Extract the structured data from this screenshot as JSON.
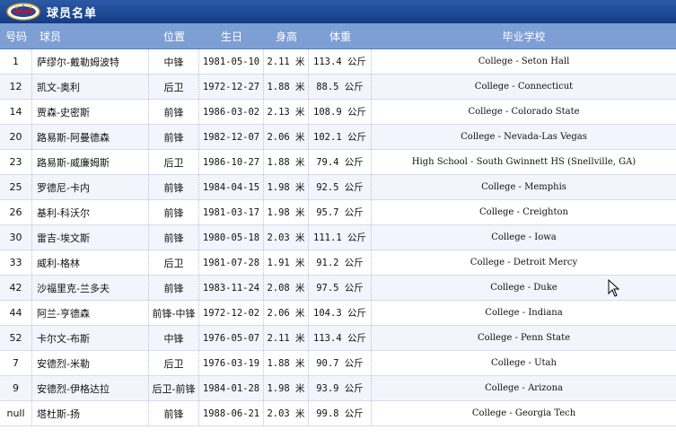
{
  "header": {
    "title": "球员名单"
  },
  "columns": {
    "number": "号码",
    "player": "球员",
    "position": "位置",
    "birthday": "生日",
    "height": "身高",
    "weight": "体重",
    "school": "毕业学校"
  },
  "players": [
    {
      "number": "1",
      "player": "萨缪尔-戴勒姆波特",
      "position": "中锋",
      "birthday": "1981-05-10",
      "height": "2.11 米",
      "weight": "113.4 公斤",
      "school": "College - Seton Hall"
    },
    {
      "number": "12",
      "player": "凯文-奥利",
      "position": "后卫",
      "birthday": "1972-12-27",
      "height": "1.88 米",
      "weight": "88.5 公斤",
      "school": "College - Connecticut"
    },
    {
      "number": "14",
      "player": "贾森-史密斯",
      "position": "前锋",
      "birthday": "1986-03-02",
      "height": "2.13 米",
      "weight": "108.9 公斤",
      "school": "College - Colorado State"
    },
    {
      "number": "20",
      "player": "路易斯-阿曼德森",
      "position": "前锋",
      "birthday": "1982-12-07",
      "height": "2.06 米",
      "weight": "102.1 公斤",
      "school": "College - Nevada-Las Vegas"
    },
    {
      "number": "23",
      "player": "路易斯-威廉姆斯",
      "position": "后卫",
      "birthday": "1986-10-27",
      "height": "1.88 米",
      "weight": "79.4 公斤",
      "school": "High School - South Gwinnett HS (Snellville, GA)"
    },
    {
      "number": "25",
      "player": "罗德尼-卡内",
      "position": "前锋",
      "birthday": "1984-04-15",
      "height": "1.98 米",
      "weight": "92.5 公斤",
      "school": "College - Memphis"
    },
    {
      "number": "26",
      "player": "基利-科沃尔",
      "position": "前锋",
      "birthday": "1981-03-17",
      "height": "1.98 米",
      "weight": "95.7 公斤",
      "school": "College - Creighton"
    },
    {
      "number": "30",
      "player": "雷吉-埃文斯",
      "position": "前锋",
      "birthday": "1980-05-18",
      "height": "2.03 米",
      "weight": "111.1 公斤",
      "school": "College - Iowa"
    },
    {
      "number": "33",
      "player": "威利-格林",
      "position": "后卫",
      "birthday": "1981-07-28",
      "height": "1.91 米",
      "weight": "91.2 公斤",
      "school": "College - Detroit Mercy"
    },
    {
      "number": "42",
      "player": "沙福里克-兰多夫",
      "position": "前锋",
      "birthday": "1983-11-24",
      "height": "2.08 米",
      "weight": "97.5 公斤",
      "school": "College - Duke"
    },
    {
      "number": "44",
      "player": "阿兰-亨德森",
      "position": "前锋-中锋",
      "birthday": "1972-12-02",
      "height": "2.06 米",
      "weight": "104.3 公斤",
      "school": "College - Indiana"
    },
    {
      "number": "52",
      "player": "卡尔文-布斯",
      "position": "中锋",
      "birthday": "1976-05-07",
      "height": "2.11 米",
      "weight": "113.4 公斤",
      "school": "College - Penn State"
    },
    {
      "number": "7",
      "player": "安德烈-米勒",
      "position": "后卫",
      "birthday": "1976-03-19",
      "height": "1.88 米",
      "weight": "90.7 公斤",
      "school": "College - Utah"
    },
    {
      "number": "9",
      "player": "安德烈-伊格达拉",
      "position": "后卫-前锋",
      "birthday": "1984-01-28",
      "height": "1.98 米",
      "weight": "93.9 公斤",
      "school": "College - Arizona"
    },
    {
      "number": "null",
      "player": "塔杜斯-扬",
      "position": "前锋",
      "birthday": "1988-06-21",
      "height": "2.03 米",
      "weight": "99.8 公斤",
      "school": "College - Georgia Tech"
    }
  ],
  "colors": {
    "title_bar": "#1f4a96",
    "header_row": "#7e9fd4",
    "logo_red": "#c8102e",
    "logo_gold": "#d4a82a"
  },
  "icons": {
    "logo": "team-logo-icon",
    "cursor": "mouse-cursor-icon"
  }
}
